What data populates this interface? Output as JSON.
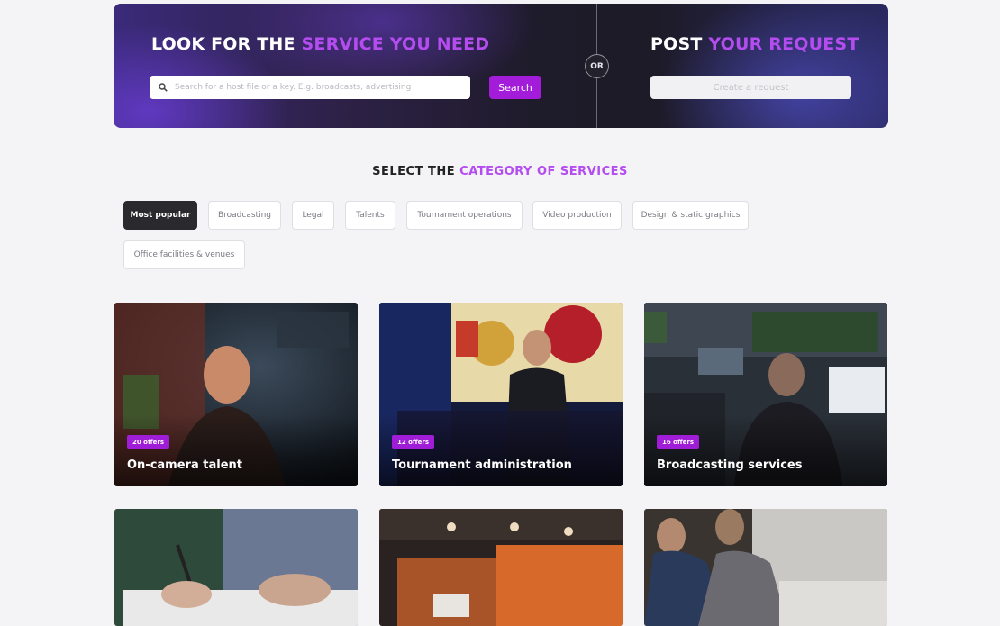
{
  "hero": {
    "look_title_plain": "LOOK FOR THE",
    "look_title_accent": "SERVICE YOU NEED",
    "search_placeholder": "Search for a host file or a key. E.g. broadcasts, advertising",
    "search_button": "Search",
    "or_label": "OR",
    "post_title_plain": "POST",
    "post_title_accent": "YOUR REQUEST",
    "request_button": "Create a request"
  },
  "categories": {
    "title_plain": "SELECT THE",
    "title_accent": "CATEGORY OF SERVICES",
    "chips": [
      {
        "label": "Most popular",
        "active": true
      },
      {
        "label": "Broadcasting",
        "active": false
      },
      {
        "label": "Legal",
        "active": false
      },
      {
        "label": "Talents",
        "active": false
      },
      {
        "label": "Tournament operations",
        "active": false
      },
      {
        "label": "Video production",
        "active": false
      },
      {
        "label": "Design & static graphics",
        "active": false
      },
      {
        "label": "Office facilities & venues",
        "active": false
      }
    ]
  },
  "cards": [
    {
      "title": "On-camera talent",
      "badge": "20 offers"
    },
    {
      "title": "Tournament administration",
      "badge": "12 offers"
    },
    {
      "title": "Broadcasting services",
      "badge": "16 offers"
    },
    {
      "title": "",
      "badge": ""
    },
    {
      "title": "",
      "badge": ""
    },
    {
      "title": "",
      "badge": ""
    }
  ],
  "colors": {
    "accent": "#b44cf0",
    "button_purple": "#a21cd9",
    "badge_purple": "#a01dd8",
    "chip_active": "#2a2a2e"
  }
}
